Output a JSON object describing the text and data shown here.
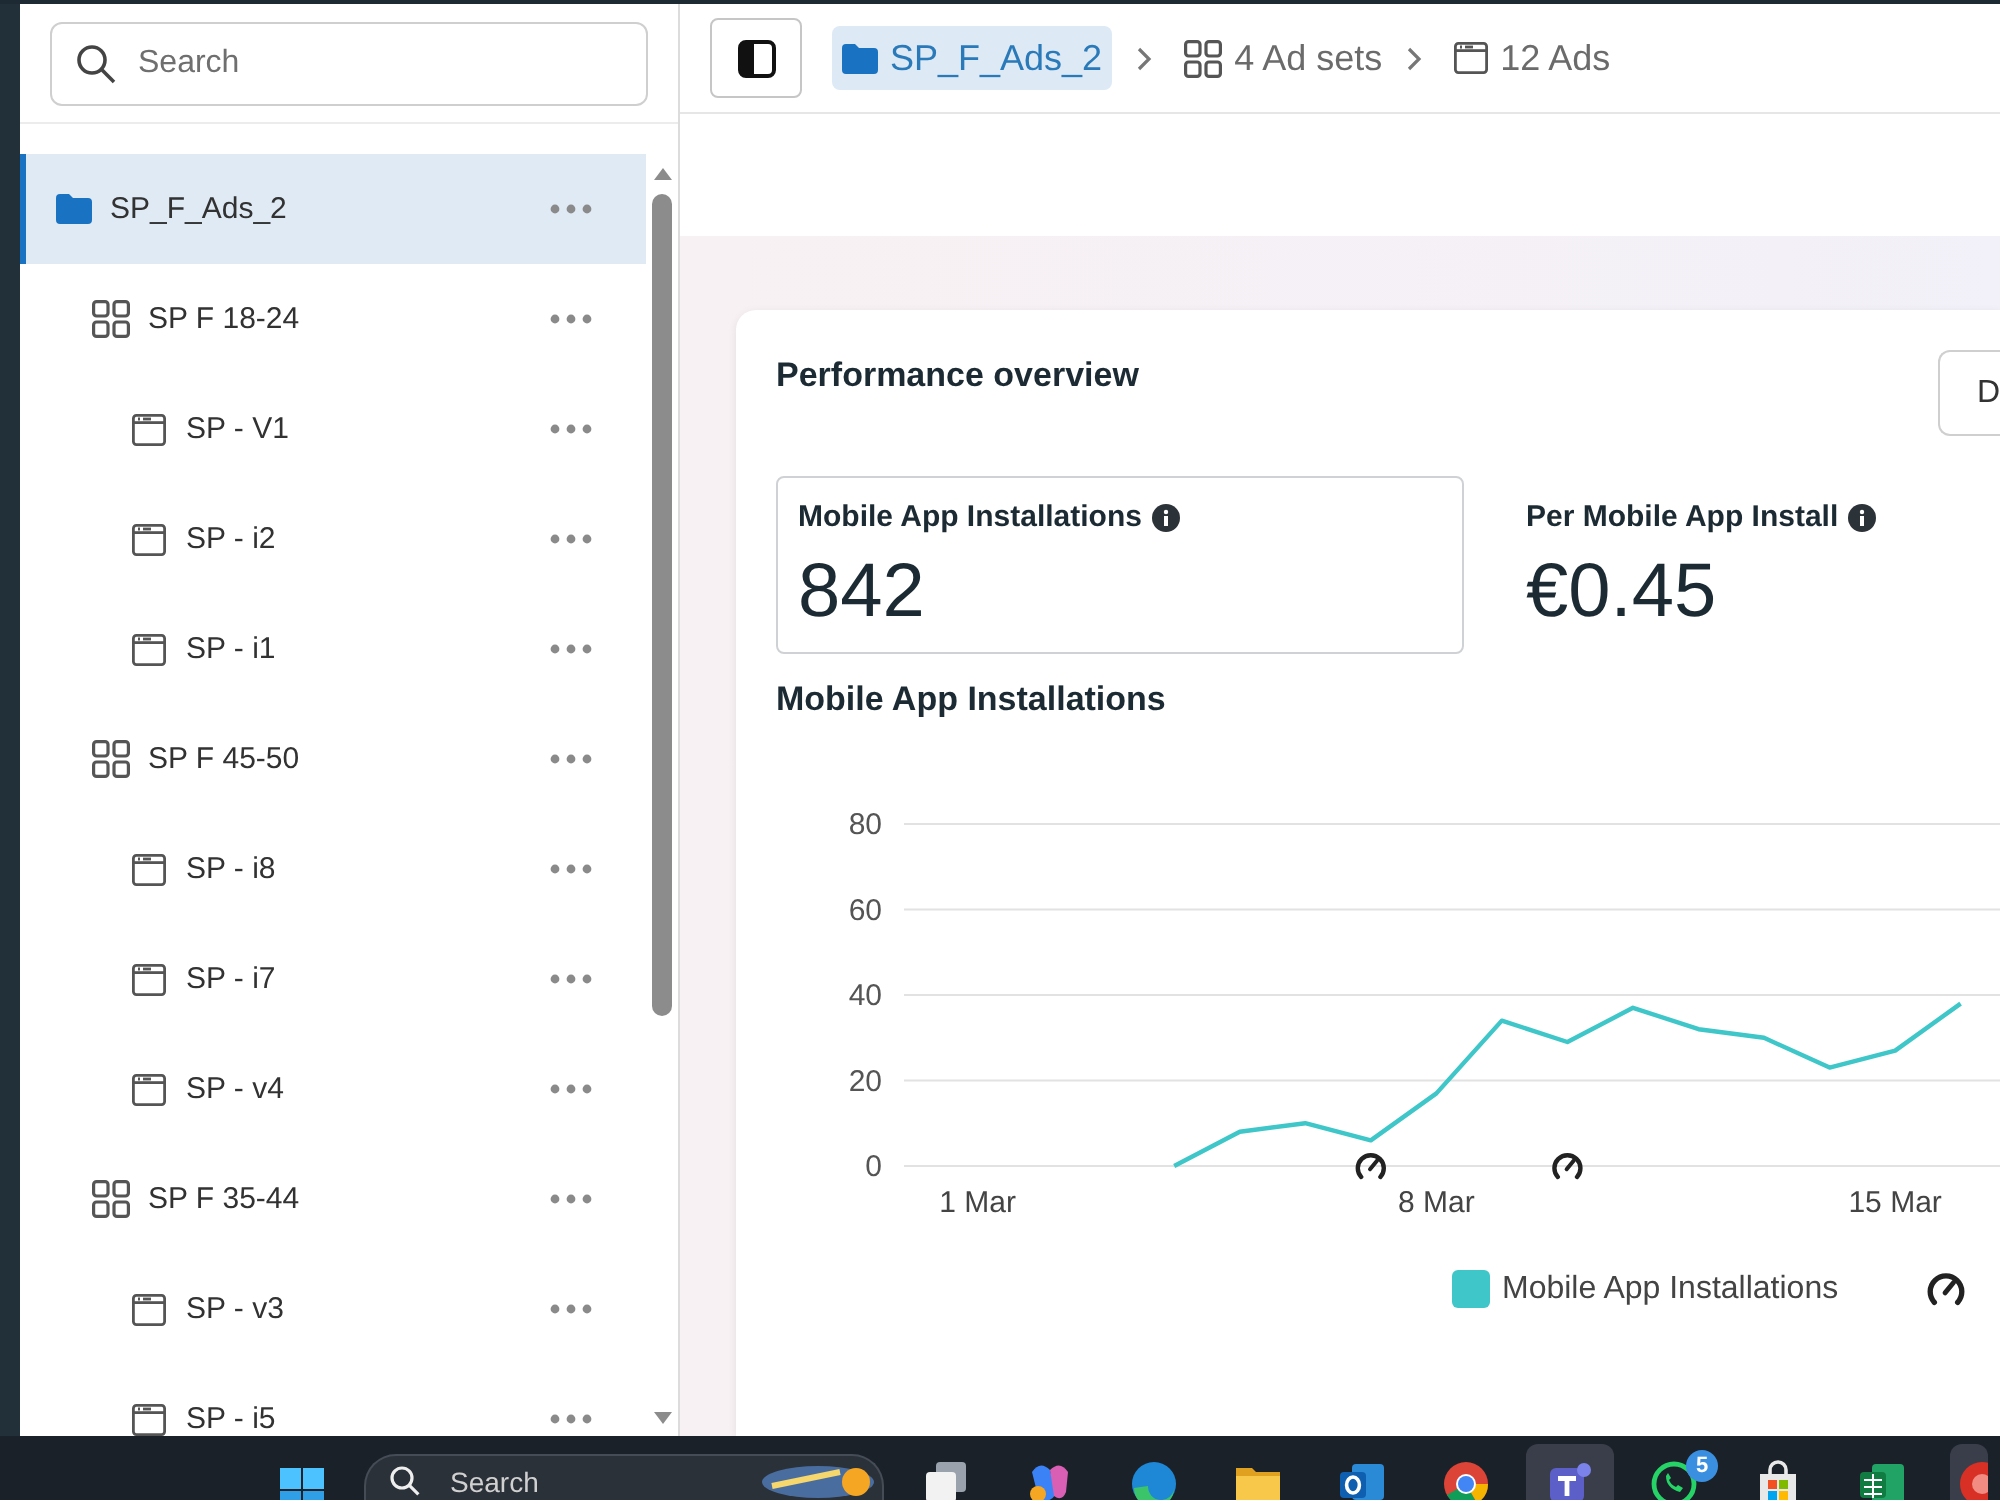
{
  "sidebar": {
    "search": {
      "placeholder": "Search"
    },
    "tree": [
      {
        "kind": "campaign",
        "label": "SP_F_Ads_2",
        "selected": true,
        "children": [
          {
            "kind": "adset",
            "label": "SP F 18-24",
            "selected": false,
            "children": [
              {
                "kind": "ad",
                "label": "SP - V1",
                "selected": false
              },
              {
                "kind": "ad",
                "label": "SP - i2",
                "selected": false
              },
              {
                "kind": "ad",
                "label": "SP - i1",
                "selected": false
              }
            ]
          },
          {
            "kind": "adset",
            "label": "SP F 45-50",
            "selected": false,
            "children": [
              {
                "kind": "ad",
                "label": "SP - i8",
                "selected": false
              },
              {
                "kind": "ad",
                "label": "SP - i7",
                "selected": false
              },
              {
                "kind": "ad",
                "label": "SP - v4",
                "selected": false
              }
            ]
          },
          {
            "kind": "adset",
            "label": "SP F 35-44",
            "selected": false,
            "children": [
              {
                "kind": "ad",
                "label": "SP - v3",
                "selected": false
              },
              {
                "kind": "ad",
                "label": "SP - i5",
                "selected": false
              }
            ]
          }
        ]
      }
    ]
  },
  "breadcrumb": [
    {
      "kind": "campaign",
      "label": "SP_F_Ads_2",
      "selected": true
    },
    {
      "kind": "adset",
      "label": "4 Ad sets",
      "selected": false
    },
    {
      "kind": "ad",
      "label": "12 Ads",
      "selected": false
    }
  ],
  "performance": {
    "title": "Performance overview",
    "button": "D",
    "metrics": [
      {
        "label": "Mobile App Installations",
        "value": "842",
        "selected": true
      },
      {
        "label": "Per Mobile App Install",
        "value": "€0.45",
        "selected": false
      }
    ],
    "chart_title": "Mobile App Installations",
    "chart_data": {
      "type": "line",
      "categories": [
        "1 Mar",
        null,
        null,
        null,
        null,
        null,
        null,
        "8 Mar",
        null,
        null,
        null,
        null,
        null,
        null,
        "15 Mar",
        null
      ],
      "series": [
        {
          "name": "Mobile App Installations",
          "color": "#3ec6c8",
          "values": [
            null,
            null,
            null,
            0,
            8,
            10,
            6,
            17,
            34,
            29,
            37,
            32,
            30,
            23,
            27,
            38
          ]
        },
        {
          "type": "scatter",
          "color": "#222222",
          "values": [
            null,
            null,
            null,
            null,
            null,
            null,
            0,
            null,
            null,
            0,
            null,
            null,
            null,
            null,
            null,
            null
          ]
        }
      ],
      "ylim": [
        0,
        80
      ],
      "yticks": [
        0,
        20,
        40,
        60,
        80
      ],
      "grid": true
    }
  },
  "taskbar": {
    "search": {
      "placeholder": "Search"
    },
    "apps": [
      {
        "kind": "taskview",
        "selected": false
      },
      {
        "kind": "copilot",
        "selected": false
      },
      {
        "kind": "edge",
        "selected": false
      },
      {
        "kind": "explorer",
        "selected": false
      },
      {
        "kind": "outlook",
        "selected": false
      },
      {
        "kind": "chrome",
        "selected": false
      },
      {
        "kind": "teams",
        "selected": true
      },
      {
        "kind": "whatsapp",
        "selected": false,
        "badge": "5"
      },
      {
        "kind": "store",
        "selected": false
      },
      {
        "kind": "excel",
        "selected": false
      },
      {
        "kind": "app",
        "selected": true
      }
    ]
  }
}
